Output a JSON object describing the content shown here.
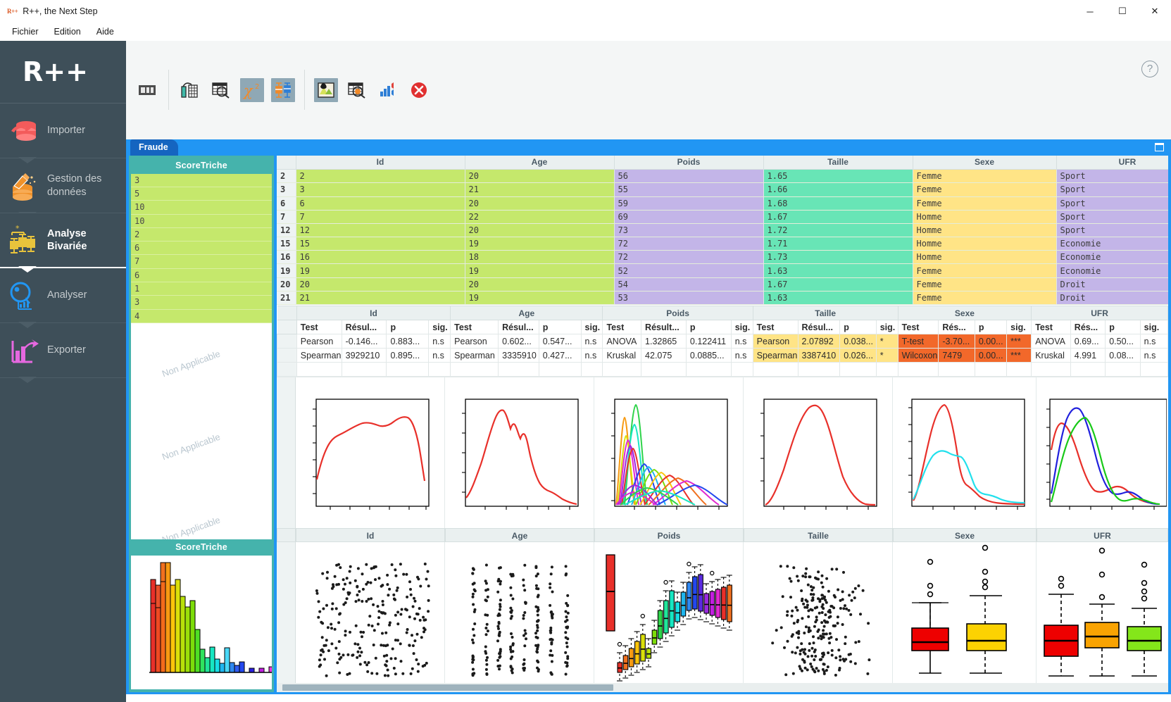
{
  "window": {
    "app_short": "R++",
    "title": "R++, the Next Step",
    "minimize": "─",
    "maximize": "☐",
    "close": "✕"
  },
  "menubar": {
    "items": [
      "Fichier",
      "Edition",
      "Aide"
    ]
  },
  "sidebar": {
    "logo": "R++",
    "items": [
      {
        "label": "Importer",
        "icon": "database-import-icon",
        "active": false
      },
      {
        "label": "Gestion des\ndonnées",
        "icon": "database-clean-icon",
        "active": false
      },
      {
        "label": "Analyse\nBivariée",
        "icon": "boxplot-icon",
        "active": true
      },
      {
        "label": "Analyser",
        "icon": "magnifier-chart-icon",
        "active": false
      },
      {
        "label": "Exporter",
        "icon": "bar-export-icon",
        "active": false
      }
    ]
  },
  "toolbar": {
    "buttons": [
      {
        "name": "table-view-icon",
        "selected": false
      },
      {
        "name": "univariate-icon",
        "selected": false
      },
      {
        "name": "table-search-icon",
        "selected": false
      },
      {
        "name": "chi2-icon",
        "selected": true
      },
      {
        "name": "boxplot-compare-icon",
        "selected": true
      },
      {
        "name": "image-export-icon",
        "selected": true
      },
      {
        "name": "table-settings-icon",
        "selected": false
      },
      {
        "name": "bar-chart-icon",
        "selected": false
      },
      {
        "name": "close-analysis-icon",
        "selected": false
      }
    ],
    "help_icon": "?"
  },
  "tabs": {
    "active": "Fraude",
    "items": [
      "Fraude"
    ]
  },
  "left_panel": {
    "header": "ScoreTriche",
    "values": [
      "3",
      "5",
      "10",
      "10",
      "2",
      "6",
      "7",
      "6",
      "1",
      "3",
      "4"
    ],
    "na_labels": [
      "Non Applicable",
      "Non Applicable",
      "Non Applicable"
    ],
    "plot_header": "ScoreTriche"
  },
  "data_table": {
    "columns": [
      "Id",
      "Age",
      "Poids",
      "Taille",
      "Sexe",
      "UFR"
    ],
    "column_colors": [
      "#c5e86c",
      "#c5e86c",
      "#c3b5e8",
      "#68e5b6",
      "#ffe486",
      "#c3b5e8"
    ],
    "rows": [
      {
        "n": "2",
        "cells": [
          "2",
          "20",
          "56",
          "1.65",
          "Femme",
          "Sport"
        ]
      },
      {
        "n": "3",
        "cells": [
          "3",
          "21",
          "55",
          "1.66",
          "Femme",
          "Sport"
        ]
      },
      {
        "n": "6",
        "cells": [
          "6",
          "20",
          "59",
          "1.68",
          "Femme",
          "Sport"
        ]
      },
      {
        "n": "7",
        "cells": [
          "7",
          "22",
          "69",
          "1.67",
          "Homme",
          "Sport"
        ]
      },
      {
        "n": "12",
        "cells": [
          "12",
          "20",
          "73",
          "1.72",
          "Homme",
          "Sport"
        ]
      },
      {
        "n": "15",
        "cells": [
          "15",
          "19",
          "72",
          "1.71",
          "Homme",
          "Economie"
        ]
      },
      {
        "n": "16",
        "cells": [
          "16",
          "18",
          "72",
          "1.73",
          "Homme",
          "Economie"
        ]
      },
      {
        "n": "19",
        "cells": [
          "19",
          "19",
          "52",
          "1.63",
          "Femme",
          "Economie"
        ]
      },
      {
        "n": "20",
        "cells": [
          "20",
          "20",
          "54",
          "1.67",
          "Femme",
          "Droit"
        ]
      },
      {
        "n": "21",
        "cells": [
          "21",
          "19",
          "53",
          "1.63",
          "Femme",
          "Droit"
        ]
      }
    ]
  },
  "stats_table": {
    "groups": [
      "Id",
      "Age",
      "Poids",
      "Taille",
      "Sexe",
      "UFR"
    ],
    "subheaders": [
      "Test",
      "Résul...",
      "p",
      "sig."
    ],
    "subheaders_poids": [
      "Test",
      "Résult...",
      "p",
      "sig."
    ],
    "subheaders_sexe": [
      "Test",
      "Rés...",
      "p",
      "sig."
    ],
    "rows": [
      {
        "cells": [
          [
            "Pearson",
            "-0.146...",
            "0.883...",
            "n.s"
          ],
          [
            "Pearson",
            "0.602...",
            "0.547...",
            "n.s"
          ],
          [
            "ANOVA",
            "1.32865",
            "0.122411",
            "n.s"
          ],
          [
            "Pearson",
            "2.07892",
            "0.038...",
            "*"
          ],
          [
            "T-test",
            "-3.70...",
            "0.00...",
            "***"
          ],
          [
            "ANOVA",
            "0.69...",
            "0.50...",
            "n.s"
          ]
        ],
        "highlight": [
          "none",
          "none",
          "none",
          "yellow",
          "orange",
          "none"
        ]
      },
      {
        "cells": [
          [
            "Spearman",
            "3929210",
            "0.895...",
            "n.s"
          ],
          [
            "Spearman",
            "3335910",
            "0.427...",
            "n.s"
          ],
          [
            "Kruskal",
            "42.075",
            "0.0885...",
            "n.s"
          ],
          [
            "Spearman",
            "3387410",
            "0.026...",
            "*"
          ],
          [
            "Wilcoxon",
            "7479",
            "0.00...",
            "***"
          ],
          [
            "Kruskal",
            "4.991",
            "0.08...",
            "n.s"
          ]
        ],
        "highlight": [
          "none",
          "none",
          "none",
          "yellow",
          "orange",
          "none"
        ]
      }
    ]
  },
  "plot_row_density": {
    "headers": [
      "",
      "",
      "",
      "",
      "",
      ""
    ]
  },
  "plot_row_scatter": {
    "headers": [
      "Id",
      "Age",
      "Poids",
      "Taille",
      "Sexe",
      "UFR"
    ]
  },
  "colors": {
    "sidebar_bg": "#3e4f59",
    "accent_blue": "#2196f3",
    "tab_blue": "#1565c0",
    "pane_teal": "#45b3ac",
    "col_green": "#c5e86c",
    "col_purple": "#c3b5e8",
    "col_teal": "#68e5b6",
    "col_yellow": "#ffe486",
    "hl_yellow": "#ffe486",
    "hl_orange": "#f2682a"
  }
}
